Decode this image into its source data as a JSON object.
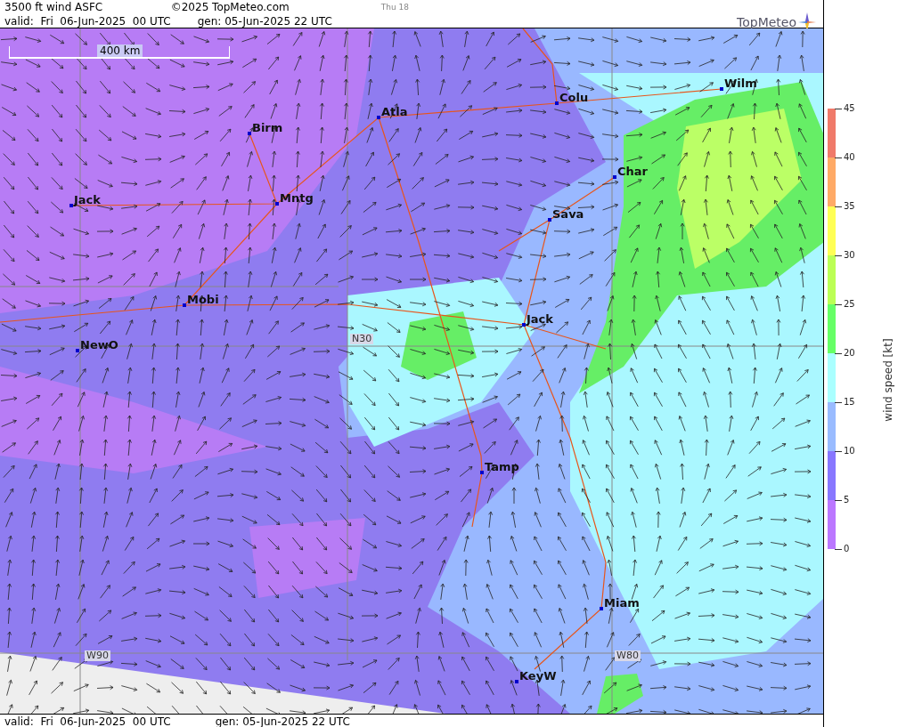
{
  "header": {
    "title": "3500 ft wind ASFC",
    "copyright": "©2025 TopMeteo.com",
    "day": "Thu 18",
    "valid": "valid:  Fri  06-Jun-2025  00 UTC",
    "gen": "gen: 05-Jun-2025 22 UTC",
    "logo": "TopMeteo"
  },
  "map": {
    "scale": "400 km",
    "cities": [
      {
        "name": "Wilm"
      },
      {
        "name": "Birm"
      },
      {
        "name": "Atla"
      },
      {
        "name": "Colu"
      },
      {
        "name": "Char"
      },
      {
        "name": "Jack"
      },
      {
        "name": "Mntg"
      },
      {
        "name": "Sava"
      },
      {
        "name": "Mobi"
      },
      {
        "name": "NewO"
      },
      {
        "name": "Jack"
      },
      {
        "name": "Tamp"
      },
      {
        "name": "Miam"
      },
      {
        "name": "KeyW"
      }
    ],
    "grid_labels": [
      "N30",
      "W90",
      "W80"
    ]
  },
  "legend": {
    "title": "wind speed [kt]",
    "ticks": [
      "45",
      "40",
      "35",
      "30",
      "25",
      "20",
      "15",
      "10",
      "5",
      "0"
    ],
    "bands": [
      {
        "color": "#f07a6a"
      },
      {
        "color": "#ffaa66"
      },
      {
        "color": "#ffff55"
      },
      {
        "color": "#bbff55"
      },
      {
        "color": "#66ff66"
      },
      {
        "color": "#aaffff"
      },
      {
        "color": "#99bbff"
      },
      {
        "color": "#8877ff"
      },
      {
        "color": "#bb77ff"
      }
    ]
  },
  "footer": {
    "valid": "valid:  Fri  06-Jun-2025  00 UTC",
    "gen": "gen: 05-Jun-2025 22 UTC"
  }
}
